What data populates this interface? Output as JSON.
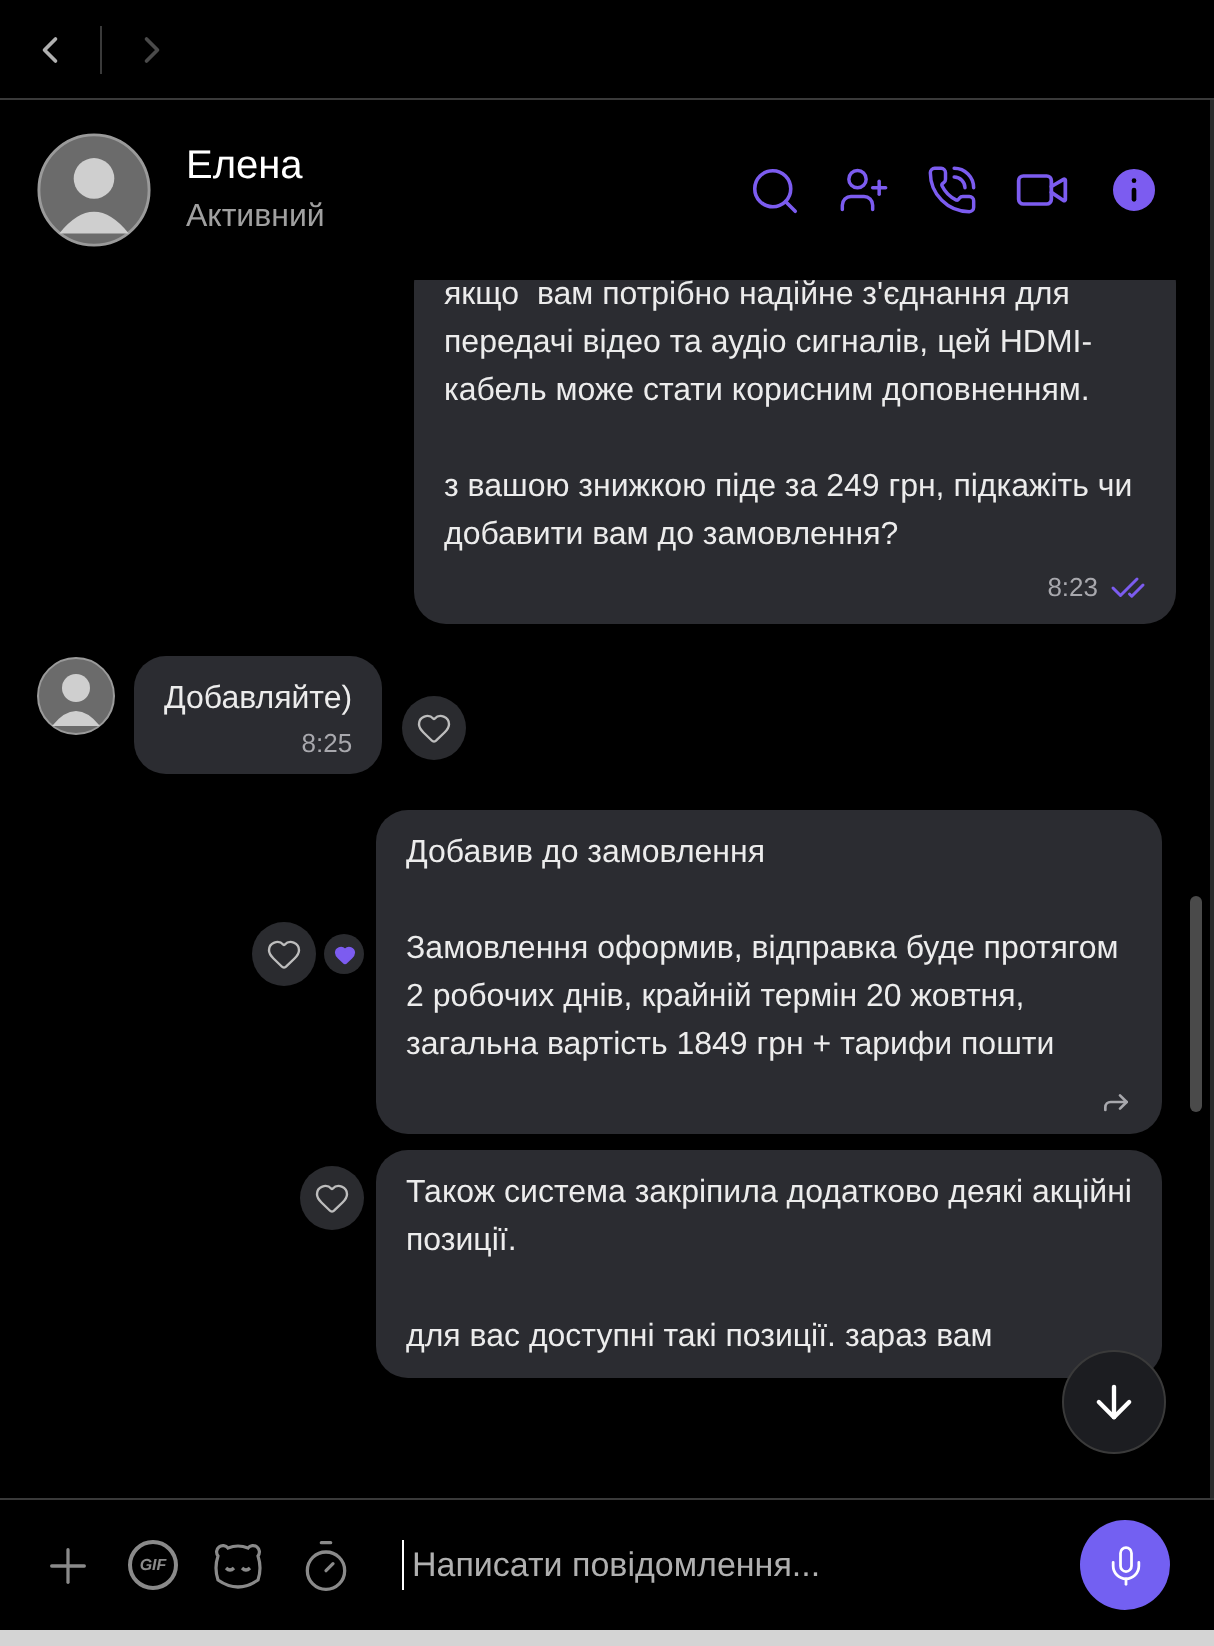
{
  "nav": {
    "back_enabled": true,
    "forward_enabled": false
  },
  "header": {
    "name": "Елена",
    "status": "Активний"
  },
  "messages": [
    {
      "kind": "outgoing",
      "text": "якщо  вам потрібно надійне з'єднання для передачі відео та аудіо сигналів, цей HDMI-кабель може стати корисним доповненням.\n\nз вашою знижкою піде за 249 грн, підкажіть чи добавити вам до замовлення?",
      "time": "8:23",
      "read": true
    },
    {
      "kind": "incoming",
      "text": "Добавляйте)",
      "time": "8:25",
      "liked": false
    },
    {
      "kind": "outgoing",
      "text": "Добавив до замовлення\n\nЗамовлення оформив, відправка буде протягом 2 робочих днів, крайній термін 20 жовтня, загальна вартість 1849 грн + тарифи пошти",
      "liked": true,
      "hovered": true
    },
    {
      "kind": "outgoing",
      "text": "Також система закріпила додатково деякі акційні позиції.\n\nдля вас доступні такі позиції. зараз вам",
      "liked": false
    }
  ],
  "composer": {
    "gif_label": "GIF",
    "placeholder": "Написати повідомлення..."
  }
}
